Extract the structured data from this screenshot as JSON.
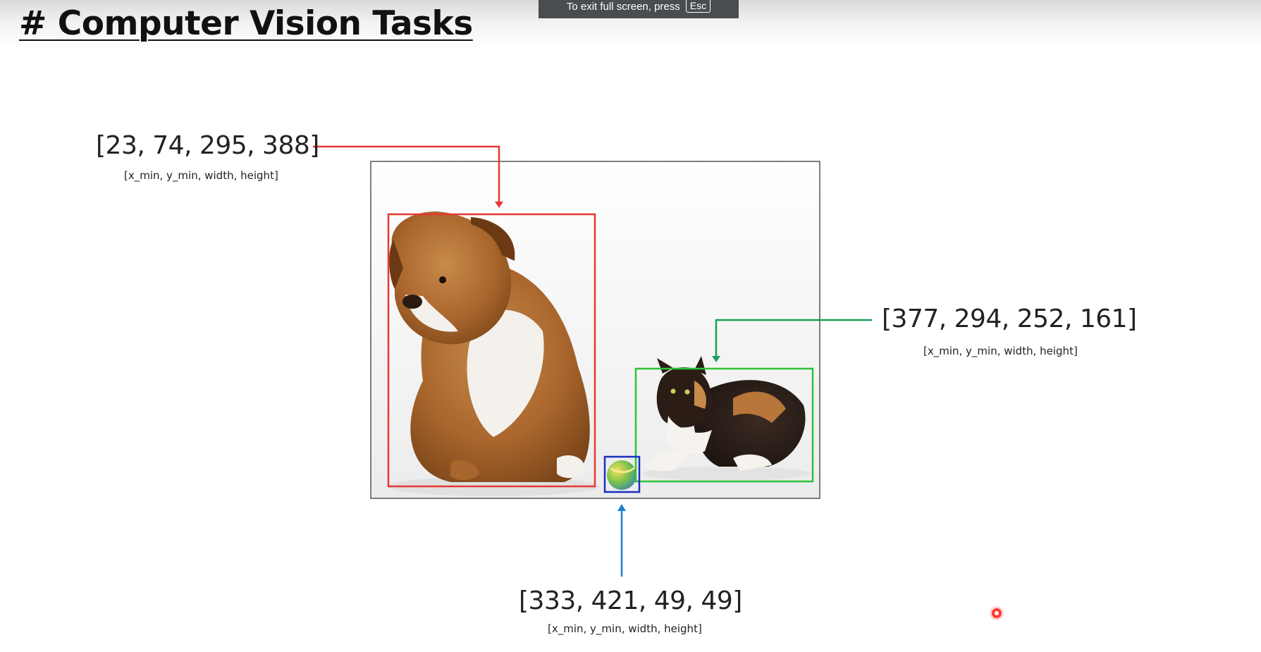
{
  "page": {
    "title": "# Computer Vision Tasks"
  },
  "fullscreen_notice": {
    "text": "To exit full screen, press",
    "key": "Esc"
  },
  "figure": {
    "objects": [
      {
        "id": "dog",
        "box_color": "#e53935",
        "coords": "[23, 74, 295, 388]",
        "format": "[x_min, y_min, width, height]"
      },
      {
        "id": "cat",
        "box_color": "#2ec23a",
        "coords": "[377, 294, 252, 161]",
        "format": "[x_min, y_min, width, height]"
      },
      {
        "id": "ball",
        "box_color": "#1a2fbf",
        "coords": "[333, 421, 49, 49]",
        "format": "[x_min, y_min, width, height]"
      }
    ],
    "arrow_colors": {
      "dog": "#e53935",
      "cat": "#1aa05a",
      "ball": "#1e7fd0"
    }
  },
  "cursor": {
    "color": "#ff3b30"
  }
}
